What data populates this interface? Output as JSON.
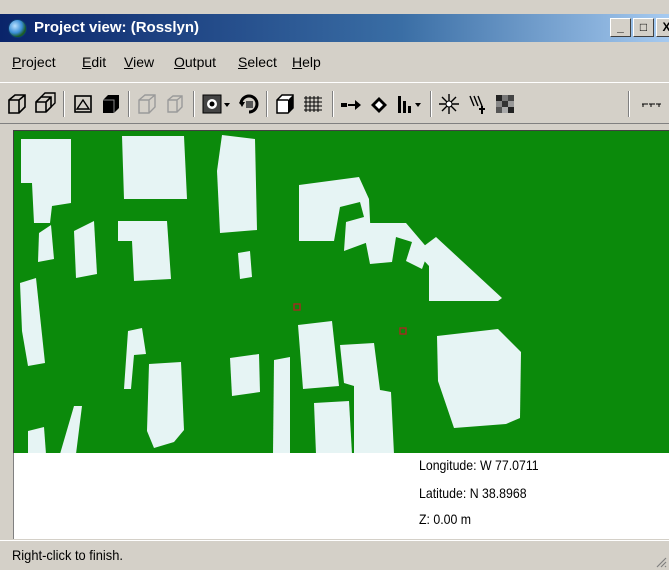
{
  "window": {
    "title": "Project view: (Rosslyn)",
    "caption_buttons": {
      "minimize": "_",
      "maximize": "□",
      "close": "X"
    }
  },
  "menu": [
    {
      "label": "Project"
    },
    {
      "label": "Edit"
    },
    {
      "label": "View"
    },
    {
      "label": "Output"
    },
    {
      "label": "Select"
    },
    {
      "label": "Help"
    }
  ],
  "toolbar": {
    "icons": [
      "wireframe-cube-icon",
      "multi-cube-icon",
      "frame-select-icon",
      "solid-cube-icon",
      "ghost-cube-icon",
      "ghost-cube-2-icon",
      "render-dropdown-icon",
      "rotate-icon",
      "shaded-cube-icon",
      "grid-icon",
      "arrow-right-icon",
      "diamond-icon",
      "bars-dropdown-icon",
      "starburst-icon",
      "rays-icon",
      "dither-icon",
      "ellipsis-icon"
    ]
  },
  "map": {
    "colors": {
      "ground": "#0b8a0b",
      "building": "#e6f4f4",
      "marker": "#b22222"
    }
  },
  "info": {
    "longitude": "Longitude: W  77.0711",
    "latitude": "Latitude: N  38.8968",
    "z": "Z: 0.00 m"
  },
  "status": {
    "message": "Right-click to finish."
  }
}
